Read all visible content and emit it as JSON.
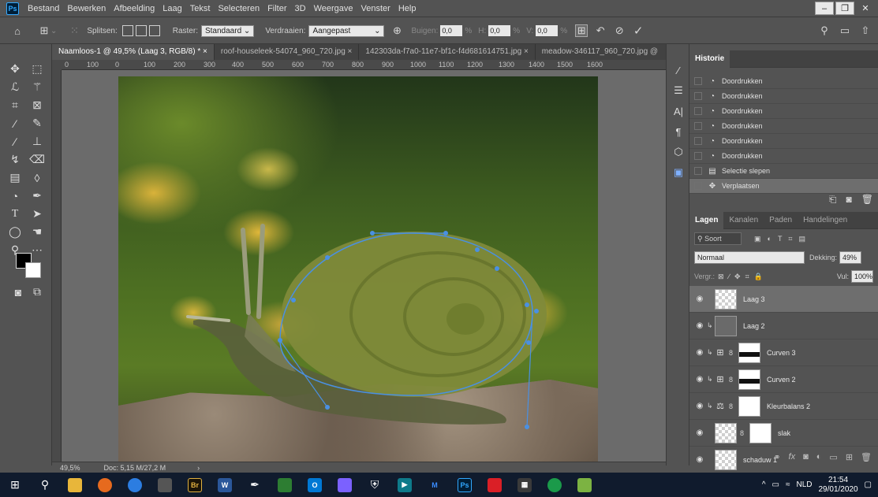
{
  "menu": {
    "logo": "Ps",
    "items": [
      "Bestand",
      "Bewerken",
      "Afbeelding",
      "Laag",
      "Tekst",
      "Selecteren",
      "Filter",
      "3D",
      "Weergave",
      "Venster",
      "Help"
    ]
  },
  "options": {
    "split_label": "Splitsen:",
    "grid_label": "Raster:",
    "grid_value": "Standaard",
    "rotate_label": "Verdraaien:",
    "rotate_value": "Aangepast",
    "bend_label": "Buigen:",
    "bend_value": "0,0",
    "h_label": "H:",
    "h_value": "0,0",
    "v_label": "V:",
    "v_value": "0,0",
    "pct": "%"
  },
  "tabs": [
    {
      "label": "Naamloos-1 @ 49,5% (Laag 3, RGB/8) *",
      "active": true
    },
    {
      "label": "roof-houseleek-54074_960_720.jpg",
      "active": false
    },
    {
      "label": "142303da-f7a0-11e7-bf1c-f4d681614751.jpg",
      "active": false
    },
    {
      "label": "meadow-346117_960_720.jpg @",
      "active": false
    }
  ],
  "ruler": [
    "0",
    "100",
    "0",
    "100",
    "200",
    "300",
    "400",
    "500",
    "600",
    "700",
    "800",
    "900",
    "1000",
    "1100",
    "1200",
    "1300",
    "1400",
    "1500",
    "1600"
  ],
  "status": {
    "zoom": "49,5%",
    "doc": "Doc: 5,15 M/27,2 M"
  },
  "history": {
    "tab": "Historie",
    "items": [
      {
        "label": "Doordrukken",
        "selected": false
      },
      {
        "label": "Doordrukken",
        "selected": false
      },
      {
        "label": "Doordrukken",
        "selected": false
      },
      {
        "label": "Doordrukken",
        "selected": false
      },
      {
        "label": "Doordrukken",
        "selected": false
      },
      {
        "label": "Doordrukken",
        "selected": false
      },
      {
        "label": "Selectie slepen",
        "selected": false
      },
      {
        "label": "Verplaatsen",
        "selected": true
      }
    ]
  },
  "layers_panel": {
    "tabs": [
      "Lagen",
      "Kanalen",
      "Paden",
      "Handelingen"
    ],
    "search": "Soort",
    "blend": "Normaal",
    "opacity_label": "Dekking:",
    "opacity": "49%",
    "lock_label": "Vergr.:",
    "fill_label": "Vul:",
    "fill": "100%",
    "layers": [
      {
        "name": "Laag 3",
        "selected": true,
        "clip": false,
        "type": "image"
      },
      {
        "name": "Laag 2",
        "selected": false,
        "clip": true,
        "type": "image"
      },
      {
        "name": "Curven 3",
        "selected": false,
        "clip": true,
        "type": "curves"
      },
      {
        "name": "Curven 2",
        "selected": false,
        "clip": true,
        "type": "curves"
      },
      {
        "name": "Kleurbalans 2",
        "selected": false,
        "clip": true,
        "type": "balance"
      },
      {
        "name": "slak",
        "selected": false,
        "clip": false,
        "type": "masked"
      },
      {
        "name": "schaduw 1",
        "selected": false,
        "clip": false,
        "type": "plain"
      }
    ]
  },
  "taskbar": {
    "lang": "NLD",
    "time": "21:54",
    "date": "29/01/2020"
  },
  "colors": {
    "ui": "#535353",
    "taskbar": "#101b2d",
    "path": "#4a90e2"
  }
}
